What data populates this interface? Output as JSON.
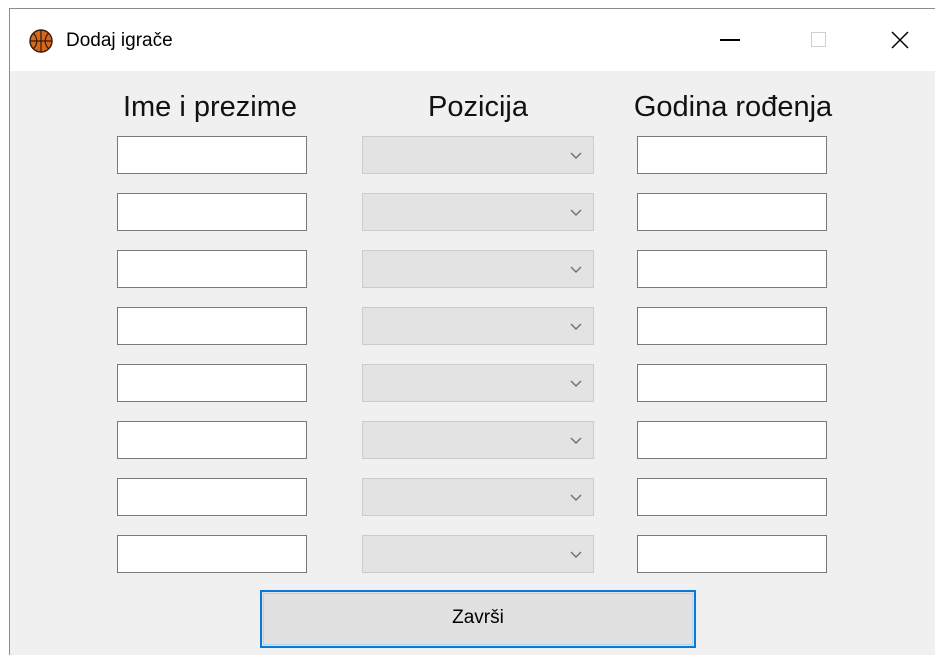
{
  "window": {
    "title": "Dodaj igrače",
    "app_icon": "basketball-icon",
    "controls": [
      "minimize-icon",
      "maximize-icon",
      "close-icon"
    ]
  },
  "columns": {
    "name_header": "Ime i prezime",
    "position_header": "Pozicija",
    "year_header": "Godina rođenja"
  },
  "rows": [
    {
      "name": "",
      "position": "",
      "year": ""
    },
    {
      "name": "",
      "position": "",
      "year": ""
    },
    {
      "name": "",
      "position": "",
      "year": ""
    },
    {
      "name": "",
      "position": "",
      "year": ""
    },
    {
      "name": "",
      "position": "",
      "year": ""
    },
    {
      "name": "",
      "position": "",
      "year": ""
    },
    {
      "name": "",
      "position": "",
      "year": ""
    },
    {
      "name": "",
      "position": "",
      "year": ""
    }
  ],
  "finish_button": {
    "label": "Završi"
  },
  "colors": {
    "window_background": "#f0f0f0",
    "focus_border": "#0a78d7",
    "combo_disabled": "#e3e3e3"
  }
}
